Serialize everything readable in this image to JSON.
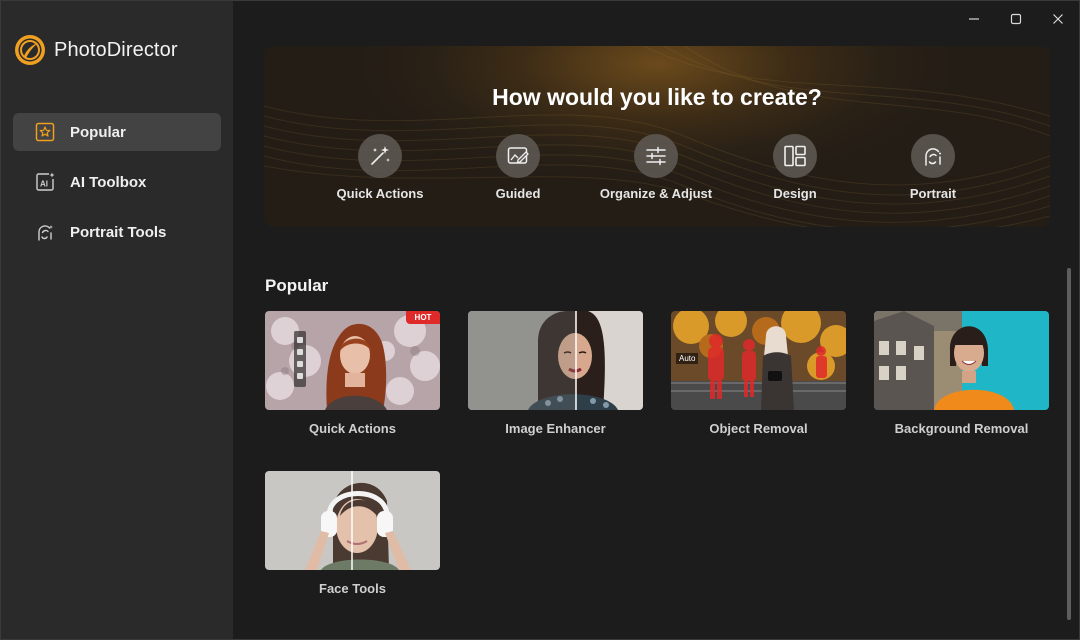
{
  "app": {
    "name": "PhotoDirector"
  },
  "window": {
    "minimize_icon": "minimize-icon",
    "maximize_icon": "maximize-icon",
    "close_icon": "close-icon"
  },
  "sidebar": {
    "items": [
      {
        "label": "Popular",
        "icon": "star-icon",
        "active": true
      },
      {
        "label": "AI Toolbox",
        "icon": "ai-icon",
        "active": false
      },
      {
        "label": "Portrait Tools",
        "icon": "portrait-icon",
        "active": false
      }
    ]
  },
  "hero": {
    "title": "How would you like to create?",
    "options": [
      {
        "label": "Quick Actions",
        "icon": "magic-wand-icon"
      },
      {
        "label": "Guided",
        "icon": "guided-icon"
      },
      {
        "label": "Organize & Adjust",
        "icon": "sliders-icon"
      },
      {
        "label": "Design",
        "icon": "layout-icon"
      },
      {
        "label": "Portrait",
        "icon": "portrait-icon"
      }
    ]
  },
  "popular": {
    "title": "Popular",
    "cards": [
      {
        "label": "Quick Actions",
        "badge": "HOT"
      },
      {
        "label": "Image Enhancer"
      },
      {
        "label": "Object Removal",
        "overlay": "Auto"
      },
      {
        "label": "Background Removal"
      },
      {
        "label": "Face Tools"
      }
    ]
  },
  "colors": {
    "sidebar_bg": "#2a2a2a",
    "main_bg": "#1c1c1c",
    "active_nav": "#434343",
    "accent_orange": "#f0a020",
    "hot_badge": "#e02a2a"
  }
}
